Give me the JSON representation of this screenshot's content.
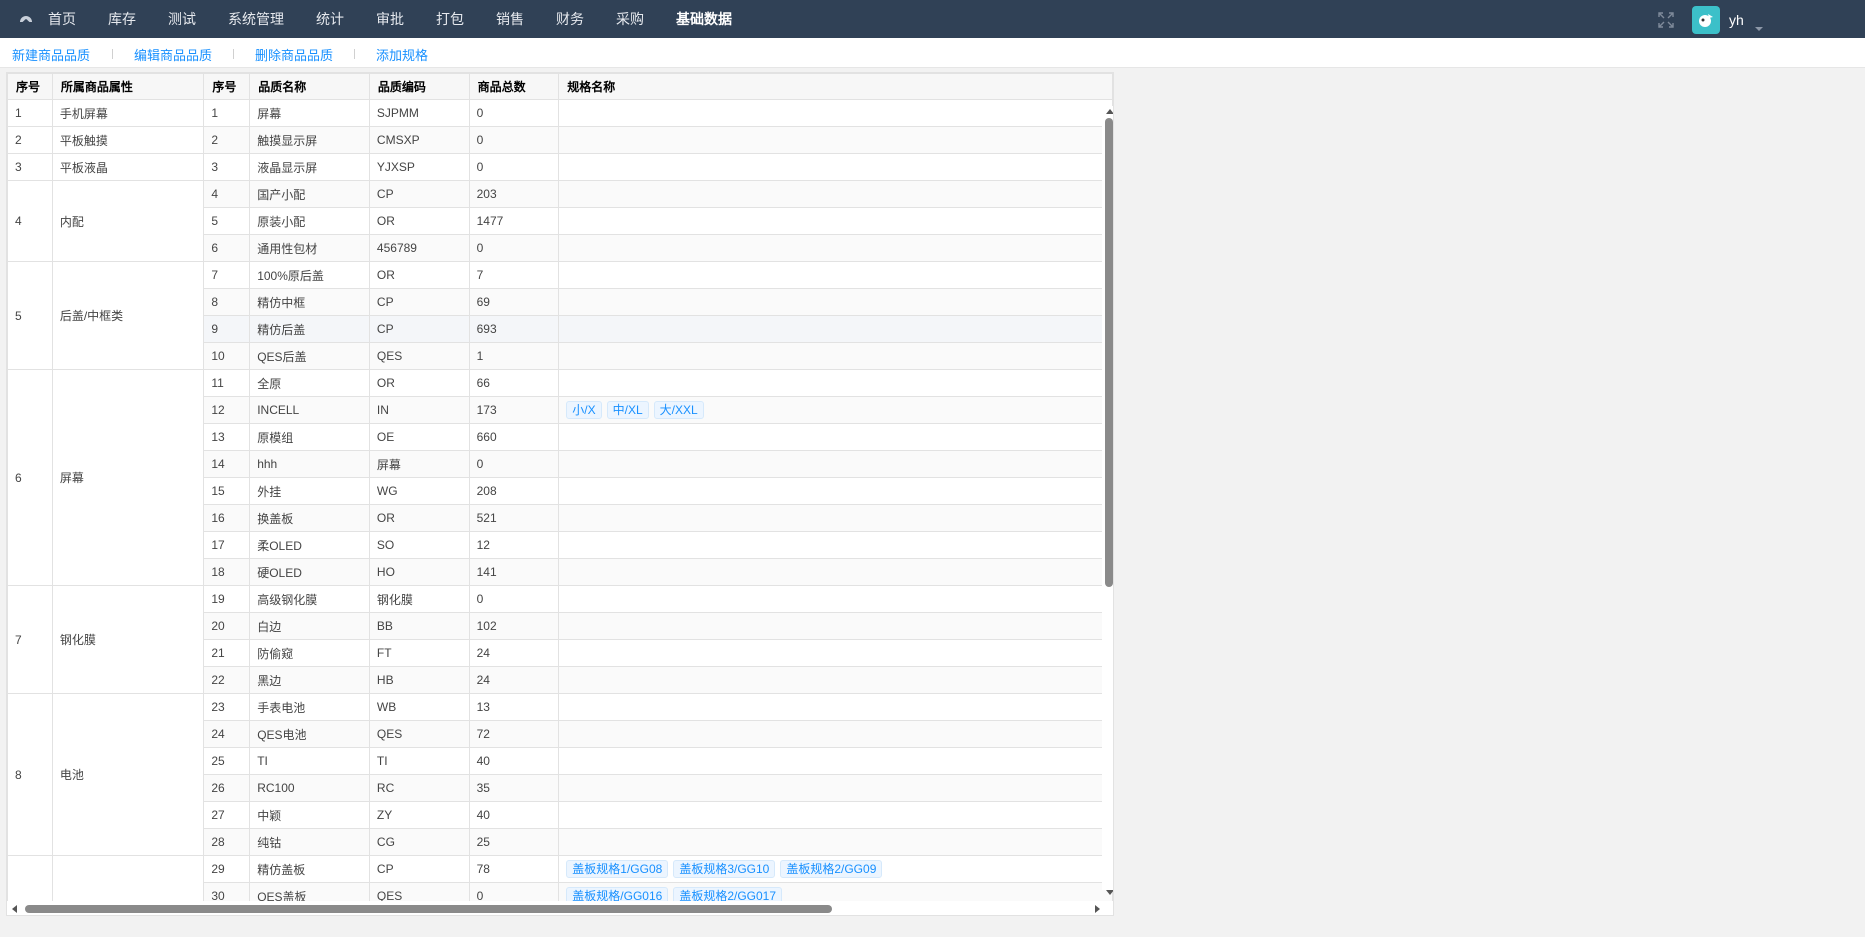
{
  "nav": {
    "items": [
      "首页",
      "库存",
      "测试",
      "系统管理",
      "统计",
      "审批",
      "打包",
      "销售",
      "财务",
      "采购",
      "基础数据"
    ],
    "active": "基础数据",
    "username": "yh"
  },
  "actions": {
    "new_label": "新建商品品质",
    "edit_label": "编辑商品品质",
    "delete_label": "删除商品品质",
    "add_spec_label": "添加规格"
  },
  "left_table": {
    "headers": [
      "序号",
      "所属商品属性"
    ],
    "groups": [
      {
        "seq": "1",
        "name": "手机屏幕",
        "rows": 1
      },
      {
        "seq": "2",
        "name": "平板触摸",
        "rows": 1
      },
      {
        "seq": "3",
        "name": "平板液晶",
        "rows": 1
      },
      {
        "seq": "4",
        "name": "内配",
        "rows": 3
      },
      {
        "seq": "5",
        "name": "后盖/中框类",
        "rows": 4
      },
      {
        "seq": "6",
        "name": "屏幕",
        "rows": 8
      },
      {
        "seq": "7",
        "name": "钢化膜",
        "rows": 4
      },
      {
        "seq": "8",
        "name": "电池",
        "rows": 6
      },
      {
        "seq": "",
        "name": "",
        "rows": 2
      }
    ]
  },
  "right_table": {
    "headers": [
      "序号",
      "品质名称",
      "品质编码",
      "商品总数",
      "规格名称"
    ],
    "rows": [
      {
        "seq": "1",
        "name": "屏幕",
        "code": "SJPMM",
        "total": "0",
        "specs": []
      },
      {
        "seq": "2",
        "name": "触摸显示屏",
        "code": "CMSXP",
        "total": "0",
        "specs": []
      },
      {
        "seq": "3",
        "name": "液晶显示屏",
        "code": "YJXSP",
        "total": "0",
        "specs": []
      },
      {
        "seq": "4",
        "name": "国产小配",
        "code": "CP",
        "total": "203",
        "specs": []
      },
      {
        "seq": "5",
        "name": "原装小配",
        "code": "OR",
        "total": "1477",
        "specs": []
      },
      {
        "seq": "6",
        "name": "通用性包材",
        "code": "456789",
        "total": "0",
        "specs": []
      },
      {
        "seq": "7",
        "name": "100%原后盖",
        "code": "OR",
        "total": "7",
        "specs": []
      },
      {
        "seq": "8",
        "name": "精仿中框",
        "code": "CP",
        "total": "69",
        "specs": []
      },
      {
        "seq": "9",
        "name": "精仿后盖",
        "code": "CP",
        "total": "693",
        "specs": []
      },
      {
        "seq": "10",
        "name": "QES后盖",
        "code": "QES",
        "total": "1",
        "specs": []
      },
      {
        "seq": "11",
        "name": "全原",
        "code": "OR",
        "total": "66",
        "specs": []
      },
      {
        "seq": "12",
        "name": "INCELL",
        "code": "IN",
        "total": "173",
        "specs": [
          "小/X",
          "中/XL",
          "大/XXL"
        ]
      },
      {
        "seq": "13",
        "name": "原模组",
        "code": "OE",
        "total": "660",
        "specs": []
      },
      {
        "seq": "14",
        "name": "hhh",
        "code": "屏幕",
        "total": "0",
        "specs": []
      },
      {
        "seq": "15",
        "name": "外挂",
        "code": "WG",
        "total": "208",
        "specs": []
      },
      {
        "seq": "16",
        "name": "换盖板",
        "code": "OR",
        "total": "521",
        "specs": []
      },
      {
        "seq": "17",
        "name": "柔OLED",
        "code": "SO",
        "total": "12",
        "specs": []
      },
      {
        "seq": "18",
        "name": "硬OLED",
        "code": "HO",
        "total": "141",
        "specs": []
      },
      {
        "seq": "19",
        "name": "高级钢化膜",
        "code": "钢化膜",
        "total": "0",
        "specs": []
      },
      {
        "seq": "20",
        "name": "白边",
        "code": "BB",
        "total": "102",
        "specs": []
      },
      {
        "seq": "21",
        "name": "防偷窥",
        "code": "FT",
        "total": "24",
        "specs": []
      },
      {
        "seq": "22",
        "name": "黑边",
        "code": "HB",
        "total": "24",
        "specs": []
      },
      {
        "seq": "23",
        "name": "手表电池",
        "code": "WB",
        "total": "13",
        "specs": []
      },
      {
        "seq": "24",
        "name": "QES电池",
        "code": "QES",
        "total": "72",
        "specs": []
      },
      {
        "seq": "25",
        "name": "TI",
        "code": "TI",
        "total": "40",
        "specs": []
      },
      {
        "seq": "26",
        "name": "RC100",
        "code": "RC",
        "total": "35",
        "specs": []
      },
      {
        "seq": "27",
        "name": "中颖",
        "code": "ZY",
        "total": "40",
        "specs": []
      },
      {
        "seq": "28",
        "name": "纯钴",
        "code": "CG",
        "total": "25",
        "specs": []
      },
      {
        "seq": "29",
        "name": "精仿盖板",
        "code": "CP",
        "total": "78",
        "specs": [
          "盖板规格1/GG08",
          "盖板规格3/GG10",
          "盖板规格2/GG09"
        ]
      },
      {
        "seq": "30",
        "name": "QES盖板",
        "code": "QES",
        "total": "0",
        "specs": [
          "盖板规格/GG016",
          "盖板规格2/GG017"
        ]
      }
    ]
  }
}
